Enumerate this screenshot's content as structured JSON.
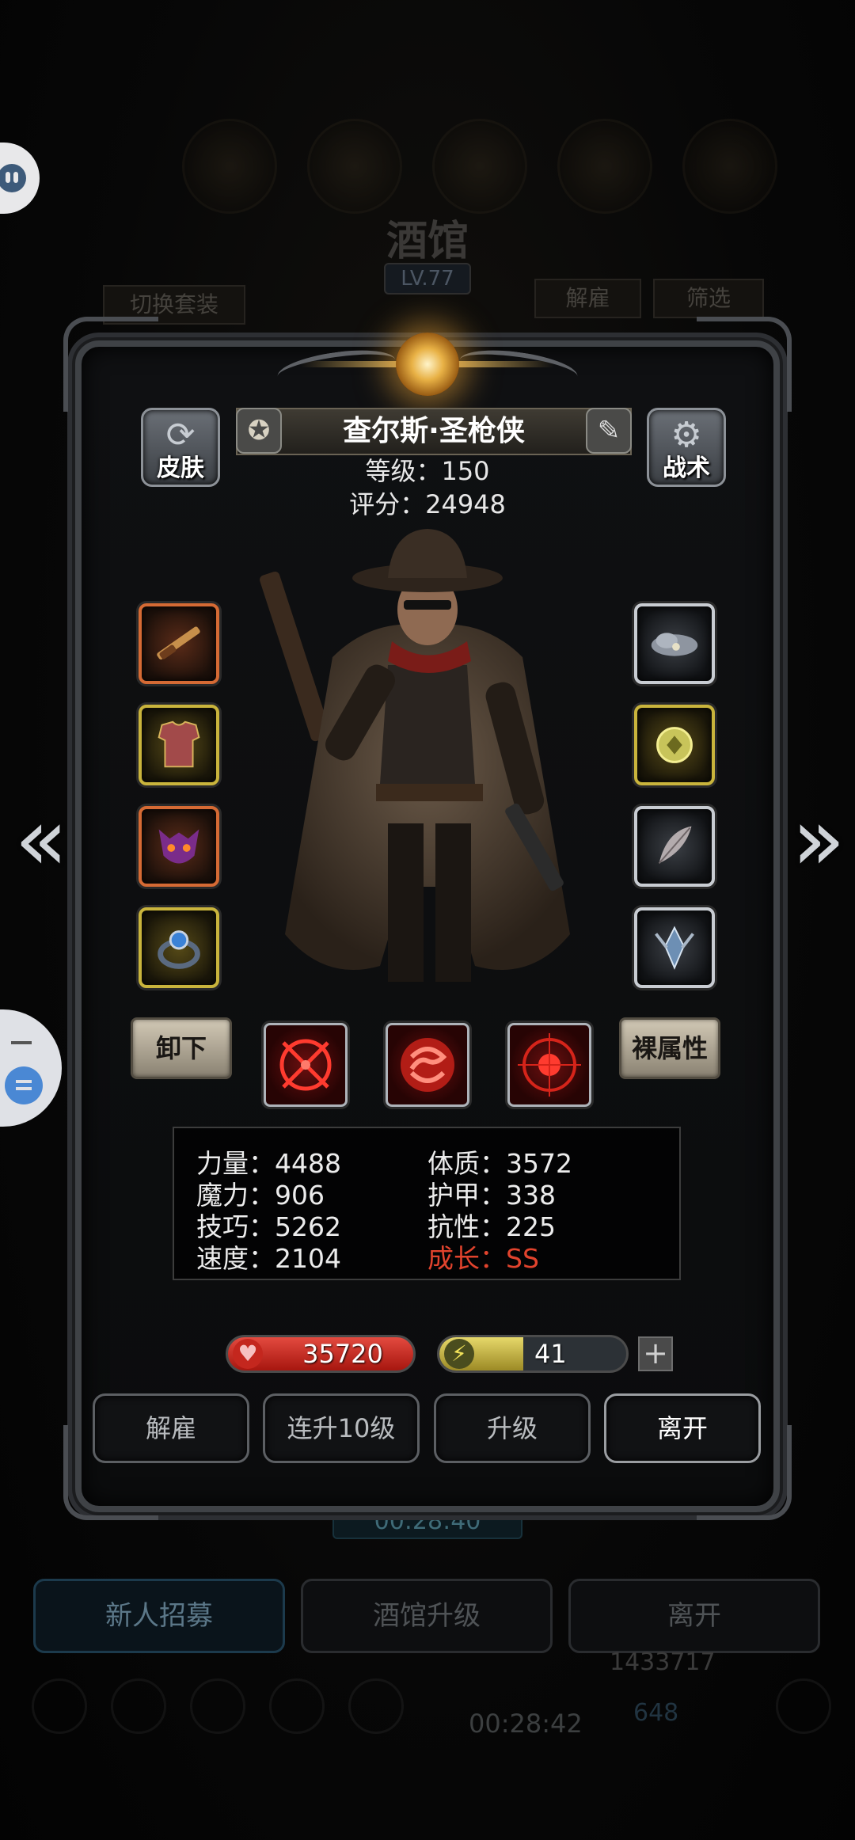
{
  "background": {
    "title": "酒馆",
    "level": "LV.77",
    "tab_left": "切换套装",
    "tab_dismiss": "解雇",
    "tab_filter": "筛选",
    "timer_top": "00:28:40",
    "bottom_buttons": [
      "新人招募",
      "酒馆升级",
      "离开"
    ],
    "timer_bottom": "00:28:42",
    "currency1": "1433717",
    "currency2": "648"
  },
  "hero": {
    "name": "查尔斯·圣枪侠",
    "level_label": "等级：150",
    "score_label": "评分：24948"
  },
  "buttons": {
    "skin": "皮肤",
    "tactic": "战术",
    "unequip": "卸下",
    "naked_attr": "裸属性"
  },
  "equipment_left": [
    {
      "icon": "rifle-icon",
      "rarity": "orange"
    },
    {
      "icon": "armor-icon",
      "rarity": "yellow"
    },
    {
      "icon": "demon-mask-icon",
      "rarity": "orange"
    },
    {
      "icon": "ring-icon",
      "rarity": "yellow"
    }
  ],
  "equipment_right": [
    {
      "icon": "storm-cloud-icon",
      "rarity": "silver"
    },
    {
      "icon": "yellow-gem-icon",
      "rarity": "yellow"
    },
    {
      "icon": "feather-icon",
      "rarity": "silver"
    },
    {
      "icon": "crystal-emblem-icon",
      "rarity": "silver"
    }
  ],
  "skills": [
    "crosshair-skill-icon",
    "vortex-skill-icon",
    "target-skill-icon"
  ],
  "attributes": {
    "strength": "力量：4488",
    "magic": "魔力：906",
    "skill": "技巧：5262",
    "speed": "速度：2104",
    "constitution": "体质：3572",
    "armor": "护甲：338",
    "resistance": "抗性：225",
    "growth": "成长：SS"
  },
  "hp": "35720",
  "energy": "41",
  "energy_fraction": 0.45,
  "actions": {
    "dismiss": "解雇",
    "level_up_10": "连升10级",
    "level_up": "升级",
    "leave": "离开"
  },
  "colors": {
    "growth": "#e1432d",
    "hp": "#c8261d",
    "energy": "#d9c94e"
  }
}
